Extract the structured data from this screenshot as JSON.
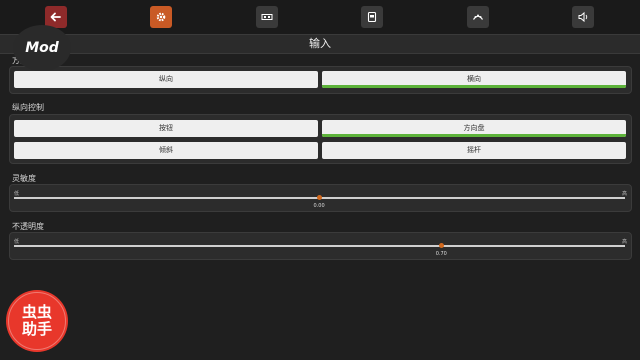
{
  "toolbar": {
    "buttons": [
      {
        "icon": "back-arrow-icon",
        "state": "back"
      },
      {
        "icon": "gear-icon",
        "state": "active"
      },
      {
        "icon": "video-icon",
        "state": "normal"
      },
      {
        "icon": "save-icon",
        "state": "normal"
      },
      {
        "icon": "controller-icon",
        "state": "normal"
      },
      {
        "icon": "speaker-icon",
        "state": "normal"
      }
    ]
  },
  "header": {
    "title": "输入"
  },
  "badge": {
    "text": "Mod"
  },
  "orientation": {
    "label": "方向",
    "options": [
      {
        "label": "纵向",
        "selected": false
      },
      {
        "label": "横向",
        "selected": true
      }
    ]
  },
  "portrait_control": {
    "label": "纵向控制",
    "options": [
      {
        "label": "按钮",
        "selected": false
      },
      {
        "label": "方向盘",
        "selected": true
      },
      {
        "label": "倾斜",
        "selected": false
      },
      {
        "label": "摇杆",
        "selected": false
      }
    ]
  },
  "sensitivity": {
    "label": "灵敏度",
    "min_label": "低",
    "max_label": "高",
    "value": 0.5,
    "value_text": "0.00"
  },
  "opacity": {
    "label": "不透明度",
    "min_label": "低",
    "max_label": "高",
    "value": 0.7,
    "value_text": "0.70"
  },
  "watermark": {
    "line1": "虫虫",
    "line2": "助手"
  },
  "colors": {
    "accent_green": "#5db33a",
    "knob": "#d2691e",
    "active_tab": "#c95a25",
    "back_button": "#8e2a2a"
  }
}
